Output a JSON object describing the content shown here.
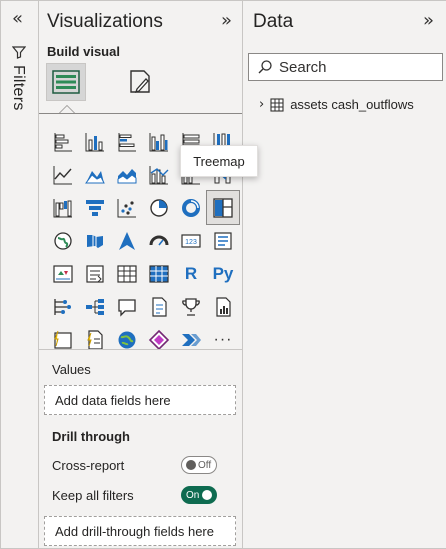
{
  "filters": {
    "label": "Filters",
    "collapse_icon": "double-chevron-left-icon"
  },
  "visualizations": {
    "title": "Visualizations",
    "build_visual_label": "Build visual",
    "tooltip": "Treemap",
    "more_label": "···",
    "r_label": "R",
    "py_label": "Py",
    "kpi_label": "123",
    "values_label": "Values",
    "values_well": "Add data fields here",
    "drill_through_label": "Drill through",
    "cross_report_label": "Cross-report",
    "cross_report_toggle": "Off",
    "keep_filters_label": "Keep all filters",
    "keep_filters_toggle": "On",
    "drill_well": "Add drill-through fields here"
  },
  "data": {
    "title": "Data",
    "search_placeholder": "Search",
    "tables": [
      "assets cash_outflows"
    ]
  },
  "colors": {
    "accent": "#1f6fbf",
    "toggle_on": "#0e6b50",
    "pane_bg": "#f3f2f1"
  }
}
